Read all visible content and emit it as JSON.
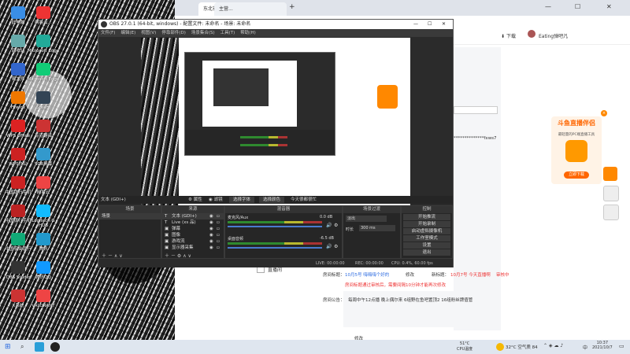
{
  "desktop": {
    "icons": [
      {
        "label": "此电脑",
        "color": "#3a8ee6"
      },
      {
        "label": "网易云...",
        "color": "#e33"
      },
      {
        "label": "回收站",
        "color": "#6aa"
      },
      {
        "label": "Microsoft Edge",
        "color": "#2a9"
      },
      {
        "label": "易大师",
        "color": "#36c"
      },
      {
        "label": "Microsoft Edge",
        "color": "#1c7"
      },
      {
        "label": "Firefox",
        "color": "#e70"
      },
      {
        "label": "Steam",
        "color": "#345"
      },
      {
        "label": "WPS Office",
        "color": "#d22"
      },
      {
        "label": "有道翻译",
        "color": "#c33"
      },
      {
        "label": "WPS办公",
        "color": "#c22"
      },
      {
        "label": "SCR屏幕",
        "color": "#39c"
      },
      {
        "label": "中国银行手机",
        "color": "#c22"
      },
      {
        "label": "网易云",
        "color": "#e44"
      },
      {
        "label": "中国银行手机",
        "color": "#b22"
      },
      {
        "label": "Logitech G HUB",
        "color": "#1bf"
      },
      {
        "label": "中国农业银行",
        "color": "#1a7"
      },
      {
        "label": "腾讯",
        "color": "#29c"
      },
      {
        "label": "OBS Studio",
        "color": "#333"
      },
      {
        "label": "腾讯QQ",
        "color": "#19f"
      },
      {
        "label": "X系统",
        "color": "#c33"
      },
      {
        "label": "VALORANT",
        "color": "#e44"
      }
    ]
  },
  "browser": {
    "tab1_title": "东北爸...",
    "tab2_title": "主营...",
    "tab_new": "+",
    "download_label": "下载",
    "user_name": "Eating弹吧儿",
    "room_title_label": "房间标题：",
    "room_title_value": "10月5号 嗨嗨嗨个好的",
    "edit_label": "修改",
    "new_title_label": "新标题：",
    "new_title_value": "10月7号 今天直播啊",
    "review_status": "审核中",
    "notice1": "房间标题通过审核后，需要间隔10分钟才能再次修改",
    "announcement_label": "房间公告：",
    "announcement_value": "每周中午12点播 晚上偶尔来 6组野在鱼吧置顶2 16组粉丝牌值管",
    "edit_label2": "修改",
    "live_section": "直播间",
    "stream_key_fragment": "**************fxws7",
    "side_ad_title": "斗鱼直播伴侣",
    "side_ad_sub": "最轻量的PC端直播工具",
    "side_ad_btn": "立即下载"
  },
  "obs": {
    "title": "OBS 27.0.1 (64-bit, windows) - 配置文件: 未命名 - 场景: 未命名",
    "menu": [
      "文件(F)",
      "编辑(E)",
      "视图(V)",
      "停靠部件(D)",
      "场景集合(S)",
      "工具(T)",
      "帮助(H)"
    ],
    "bar_source": "文本 (GDI+)",
    "bar_props": "属性",
    "bar_filters": "滤镜",
    "bar_text": "今天很都很忙",
    "docks": {
      "scenes": "场景",
      "sources": "来源",
      "mixer": "混音器",
      "transitions": "场景过渡",
      "controls": "控制"
    },
    "scenes": [
      "场景"
    ],
    "sources": [
      {
        "icon": "T",
        "name": "文本 (GDI+)"
      },
      {
        "icon": "T",
        "name": "Live (xs 品)"
      },
      {
        "icon": "▣",
        "name": "弹幕"
      },
      {
        "icon": "▣",
        "name": "图像"
      },
      {
        "icon": "▣",
        "name": "游戏流"
      },
      {
        "icon": "▣",
        "name": "显示器采集"
      }
    ],
    "mixer": [
      {
        "name": "麦克风/Aux",
        "db": "0.0 dB"
      },
      {
        "name": "桌面音频",
        "db": "-6.5 dB"
      }
    ],
    "transition_type": "淡出",
    "transition_duration_label": "时长",
    "transition_duration": "300 ms",
    "controls": [
      "开始推流",
      "开始录制",
      "启动虚拟摄像机",
      "工作室模式",
      "设置",
      "退出"
    ],
    "status": {
      "live": "LIVE: 00:00:00",
      "rec": "REC: 00:00:00",
      "cpu": "CPU: 0.4%, 60.00 fps"
    }
  },
  "taskbar": {
    "weather_temp": "51°C",
    "weather_desc": "CPU温度",
    "weather2": "32°C 空气质 84",
    "lang": "中",
    "time": "10:37",
    "date": "2021/10/7"
  }
}
